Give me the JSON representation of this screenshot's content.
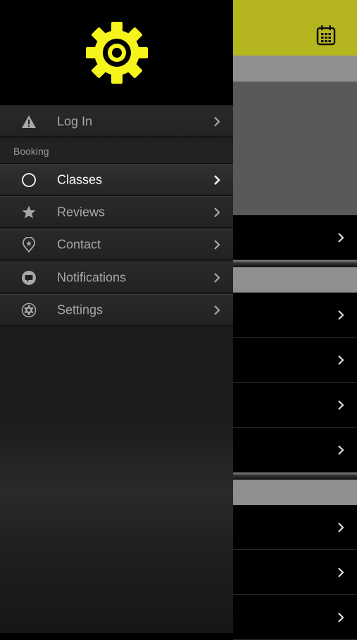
{
  "drawer": {
    "login": {
      "label": "Log In",
      "icon": "warning-icon"
    },
    "section_header": "Booking",
    "items": [
      {
        "label": "Classes",
        "icon": "circle-icon",
        "active": true
      },
      {
        "label": "Reviews",
        "icon": "star-icon",
        "active": false
      },
      {
        "label": "Contact",
        "icon": "location-pin-icon",
        "active": false
      },
      {
        "label": "Notifications",
        "icon": "chat-bubble-icon",
        "active": false
      },
      {
        "label": "Settings",
        "icon": "gear-icon",
        "active": false
      }
    ]
  },
  "colors": {
    "accent": "#f5f51c",
    "header_bar": "#b5b51f"
  }
}
